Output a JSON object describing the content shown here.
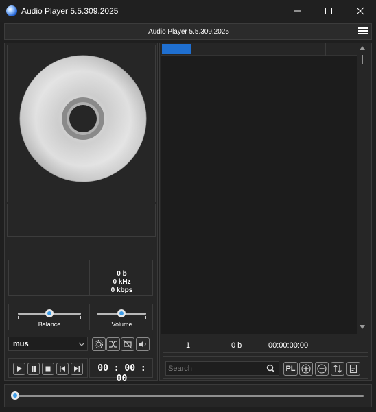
{
  "window": {
    "title": "Audio Player 5.5.309.2025"
  },
  "header": {
    "title": "Audio Player 5.5.309.2025",
    "menu_icon": "hamburger-menu-icon"
  },
  "cover": {
    "icon": "compact-disc-icon"
  },
  "stats": {
    "size": "0 b",
    "frequency": "0 kHz",
    "bitrate": "0 kbps"
  },
  "sliders": {
    "balance_label": "Balance",
    "balance_level": 0.5,
    "volume_label": "Volume",
    "volume_level": 0.5
  },
  "source": {
    "selected": "mus"
  },
  "toolbar_icons": [
    "settings-icon",
    "shuffle-icon",
    "no-repeat-icon",
    "speaker-icon"
  ],
  "transport_icons": [
    "play-icon",
    "pause-icon",
    "stop-icon",
    "previous-icon",
    "next-icon"
  ],
  "time": {
    "display": "00 : 00 : 00"
  },
  "playlist": {
    "status_count": "1",
    "status_size": "0 b",
    "status_duration": "00:00:00:00"
  },
  "search": {
    "placeholder": "Search"
  },
  "playlist_buttons": {
    "playlist_label": "PL",
    "icons": [
      "add-icon",
      "remove-icon",
      "sort-icon",
      "playlist-file-icon"
    ]
  },
  "seek": {
    "position": 0
  },
  "colors": {
    "accent": "#1f6fd0",
    "thumb_center": "#3f9de8",
    "background": "#1f1f1f"
  }
}
